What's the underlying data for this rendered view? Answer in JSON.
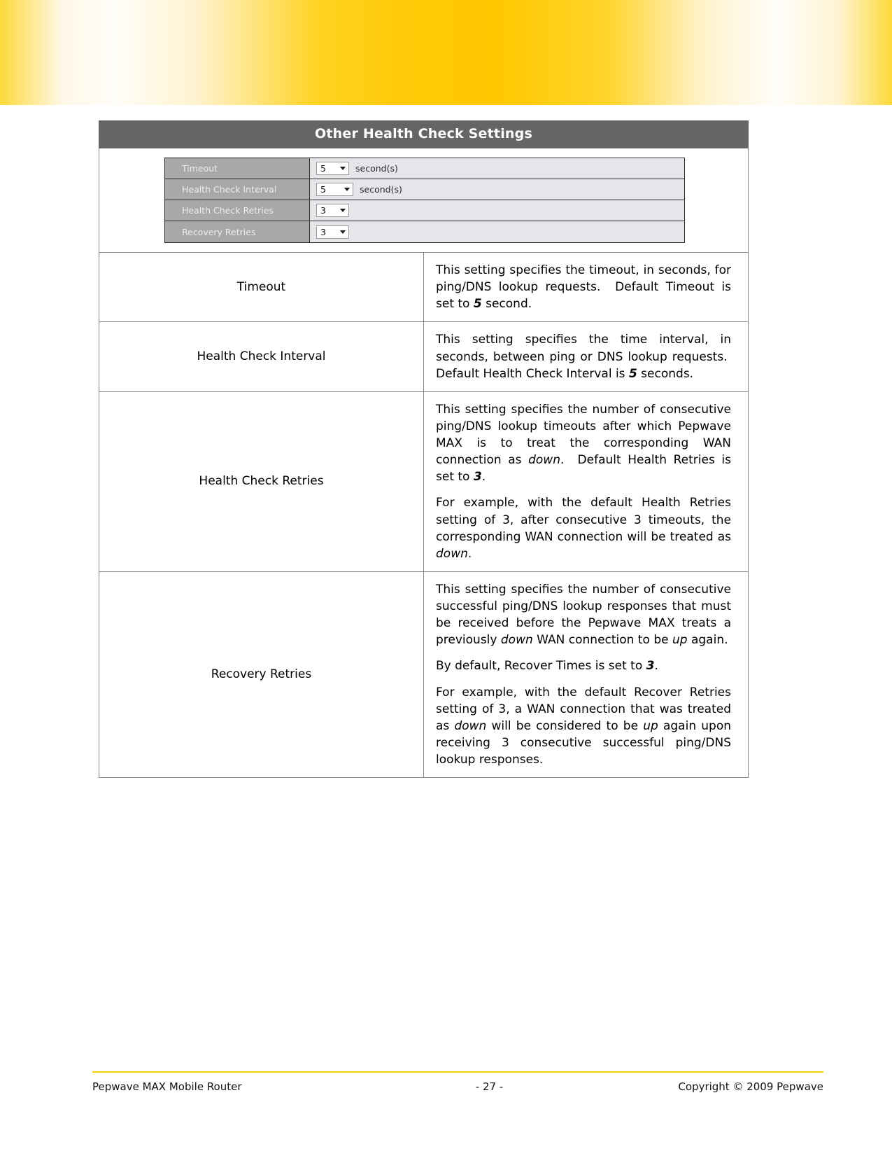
{
  "banner": {
    "accent_yellow": "#ffc800",
    "accent_yellow_edge": "#fdd93a"
  },
  "table": {
    "header_title": "Other Health Check Settings",
    "header_bg": "#656565"
  },
  "screenshot_form": {
    "rows": [
      {
        "label": "Timeout",
        "value": "5",
        "unit": "second(s)"
      },
      {
        "label": "Health Check Interval",
        "value": "5",
        "unit": "second(s)"
      },
      {
        "label": "Health Check Retries",
        "value": "3",
        "unit": ""
      },
      {
        "label": "Recovery Retries",
        "value": "3",
        "unit": ""
      }
    ]
  },
  "descriptions": [
    {
      "term": "Timeout",
      "paragraphs": [
        "This setting specifies the timeout, in seconds, for ping/DNS lookup requests.  Default Timeout is set to 5 second."
      ]
    },
    {
      "term": "Health Check Interval",
      "paragraphs": [
        "This setting specifies the time interval, in seconds, between ping or DNS lookup requests.  Default Health Check Interval is 5 seconds."
      ]
    },
    {
      "term": "Health Check Retries",
      "paragraphs": [
        "This setting specifies the number of consecutive ping/DNS lookup timeouts after which Pepwave MAX is to treat the corresponding WAN connection as down.  Default Health Retries is set to 3.",
        "For example, with the default Health Retries setting of 3, after consecutive 3 timeouts, the corresponding WAN connection will be treated as down."
      ]
    },
    {
      "term": "Recovery Retries",
      "paragraphs": [
        "This setting specifies the number of consecutive successful ping/DNS lookup responses that must be received before the Pepwave MAX treats a previously down WAN connection to be up again.",
        "By default, Recover Times is set to 3.",
        "For example, with the default Recover Retries setting of 3, a WAN connection that was treated as down will be considered to be up again upon receiving 3 consecutive successful ping/DNS lookup responses."
      ]
    }
  ],
  "footer": {
    "left": "Pepwave MAX Mobile Router",
    "center": "- 27 -",
    "right": "Copyright © 2009 Pepwave",
    "rule_color": "#ffd100"
  }
}
